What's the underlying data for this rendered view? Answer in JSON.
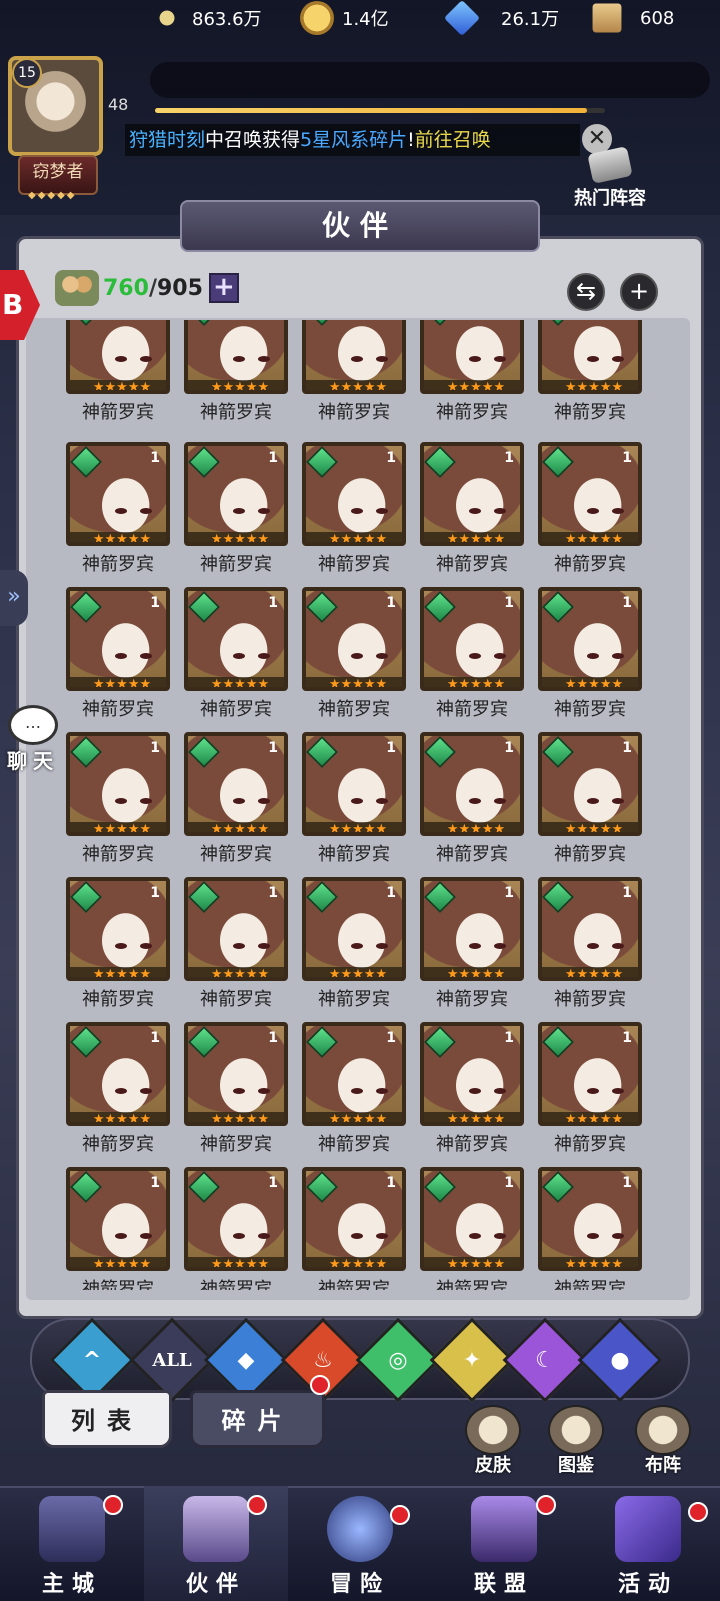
{
  "player": {
    "level": "15",
    "vip": "48",
    "title": "窃梦者",
    "title_stars": "◆◆◆◆◆"
  },
  "resources": [
    {
      "name": "power",
      "icon": "sword-icon",
      "value": "863.6万"
    },
    {
      "name": "gold",
      "icon": "coin-icon",
      "value": "1.4亿"
    },
    {
      "name": "diamond",
      "icon": "gem-icon",
      "value": "26.1万"
    },
    {
      "name": "scroll",
      "icon": "scroll-icon",
      "value": "608"
    }
  ],
  "xp_fraction": 0.96,
  "marquee": {
    "part1": "狩猎时刻",
    "part2": "中召唤获得",
    "part3": "5星风系碎片",
    "part4": "!",
    "part5": "前往召唤"
  },
  "hot_lineup": "热门阵容",
  "header_title": "伙伴",
  "hero_count": {
    "current": "760",
    "sep": "/",
    "max": "905",
    "add": "+"
  },
  "buttons": {
    "swap": "⇆",
    "plus": "+"
  },
  "hero_name": "神箭罗宾",
  "hero_level": "1",
  "hero_stars": "★★★★★",
  "filters": [
    {
      "name": "water",
      "label": "^",
      "color": "#3a9fd0"
    },
    {
      "name": "all",
      "label": "ALL",
      "color": "#3a3c5a"
    },
    {
      "name": "water-drop",
      "label": "◆",
      "color": "#3b7fd6"
    },
    {
      "name": "fire",
      "label": "♨",
      "color": "#d94a2a"
    },
    {
      "name": "wind",
      "label": "◎",
      "color": "#3fbf6a"
    },
    {
      "name": "light",
      "label": "✦",
      "color": "#d8c04a"
    },
    {
      "name": "dark",
      "label": "☾",
      "color": "#9a55d8"
    },
    {
      "name": "planet",
      "label": "●",
      "color": "#4a55c8"
    }
  ],
  "tabs": {
    "list": "列表",
    "fragments": "碎片"
  },
  "quick_actions": {
    "skins": "皮肤",
    "gallery": "图鉴",
    "lineup": "布阵"
  },
  "nav": {
    "town": "主城",
    "partners": "伙伴",
    "adventure": "冒险",
    "alliance": "联盟",
    "activity": "活动"
  },
  "side": {
    "arrow": "»",
    "chat": "聊天",
    "chat_icon": "…",
    "red_tab": "B"
  }
}
